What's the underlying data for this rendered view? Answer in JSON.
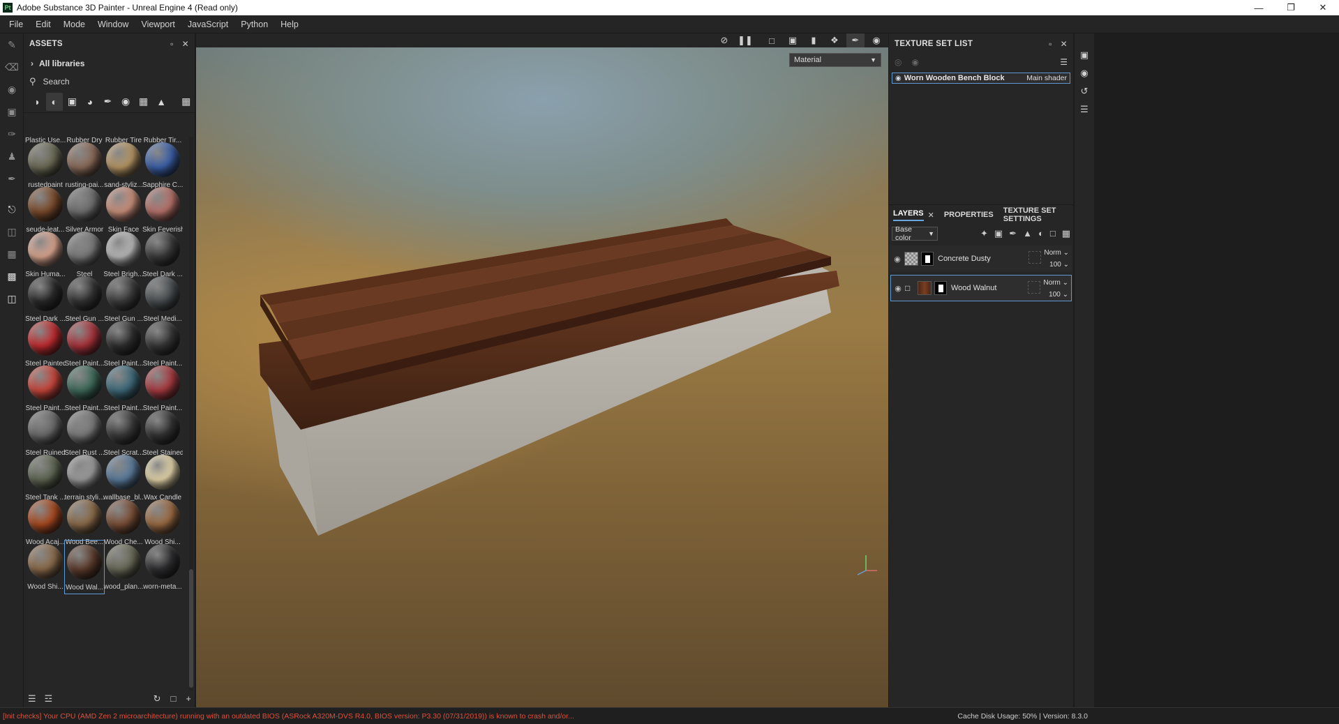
{
  "window": {
    "title": "Adobe Substance 3D Painter - Unreal Engine 4 (Read only)",
    "icon_text": "Pt",
    "controls": [
      "minimize-icon",
      "restore-icon",
      "close-icon"
    ]
  },
  "menu": [
    "File",
    "Edit",
    "Mode",
    "Window",
    "Viewport",
    "JavaScript",
    "Python",
    "Help"
  ],
  "assets": {
    "title": "ASSETS",
    "all_libraries": "All libraries",
    "search_placeholder": "Search",
    "filter_icons": [
      "materials-icon",
      "smart-materials-icon",
      "masks-icon",
      "generators-icon",
      "brushes-icon",
      "alphas-icon",
      "textures-icon",
      "environments-icon",
      "grid-view-icon"
    ],
    "materials": [
      {
        "label": "Plastic Use...",
        "color": "#6a5a48"
      },
      {
        "label": "Rubber Dry",
        "color": "#3a3836"
      },
      {
        "label": "Rubber Tire",
        "color": "#2a2a2a"
      },
      {
        "label": "Rubber Tir...",
        "color": "#2c2c2c"
      },
      {
        "label": "rustedpaint",
        "color": "#6b6a55"
      },
      {
        "label": "rusting-pai...",
        "color": "#8a6a58"
      },
      {
        "label": "sand-styliz...",
        "color": "#b59563"
      },
      {
        "label": "Sapphire C...",
        "color": "#3a5fa8"
      },
      {
        "label": "seude-leat...",
        "color": "#7a4a2a"
      },
      {
        "label": "Silver Armor",
        "color": "#6e6e6e"
      },
      {
        "label": "Skin Face",
        "color": "#c98e7a"
      },
      {
        "label": "Skin Feverish",
        "color": "#b7716a"
      },
      {
        "label": "Skin Huma...",
        "color": "#d9a48e"
      },
      {
        "label": "Steel",
        "color": "#7a7a7a"
      },
      {
        "label": "Steel Brigh...",
        "color": "#b8b8b8"
      },
      {
        "label": "Steel Dark ...",
        "color": "#3a3a3a"
      },
      {
        "label": "Steel Dark ...",
        "color": "#2a2a2a"
      },
      {
        "label": "Steel Gun ...",
        "color": "#333333"
      },
      {
        "label": "Steel Gun ...",
        "color": "#3c3c3c"
      },
      {
        "label": "Steel Medi...",
        "color": "#4a4f52"
      },
      {
        "label": "Steel Painted",
        "color": "#c02a2e"
      },
      {
        "label": "Steel Paint...",
        "color": "#a8323a"
      },
      {
        "label": "Steel Paint...",
        "color": "#2e2e2e"
      },
      {
        "label": "Steel Paint...",
        "color": "#363636"
      },
      {
        "label": "Steel Paint...",
        "color": "#c8453a"
      },
      {
        "label": "Steel Paint...",
        "color": "#3e6a5a"
      },
      {
        "label": "Steel Paint...",
        "color": "#3e6a7a"
      },
      {
        "label": "Steel Paint...",
        "color": "#a83a40"
      },
      {
        "label": "Steel Ruined",
        "color": "#6a6a6a"
      },
      {
        "label": "Steel Rust ...",
        "color": "#7a7a7a"
      },
      {
        "label": "Steel Scrat...",
        "color": "#3a3a3a"
      },
      {
        "label": "Steel Stained",
        "color": "#333333"
      },
      {
        "label": "Steel Tank ...",
        "color": "#5e6652"
      },
      {
        "label": "terrain styli...",
        "color": "#9a9a9a"
      },
      {
        "label": "wallbase_bl...",
        "color": "#5a7a9a"
      },
      {
        "label": "Wax Candle",
        "color": "#e2d4a8"
      },
      {
        "label": "Wood Acaj...",
        "color": "#a8481e"
      },
      {
        "label": "Wood Bee...",
        "color": "#8a6a48"
      },
      {
        "label": "Wood Che...",
        "color": "#7a4e36"
      },
      {
        "label": "Wood Shi...",
        "color": "#9a6a42"
      },
      {
        "label": "Wood Shi...",
        "color": "#8a6a4a"
      },
      {
        "label": "Wood Wal...",
        "color": "#5a3a2a"
      },
      {
        "label": "wood_plan...",
        "color": "#6a6a58"
      },
      {
        "label": "worn-meta...",
        "color": "#2e2e30"
      }
    ]
  },
  "viewport": {
    "channel_dropdown": "Material",
    "toolbar_icons": [
      "hide-ui-icon",
      "pause-icon",
      "display-mode-icon",
      "camera-mode-icon",
      "video-icon",
      "symmetry-icon",
      "paint-mode-icon",
      "screenshot-icon"
    ]
  },
  "texture_set_list": {
    "title": "TEXTURE SET LIST",
    "set_name": "Worn Wooden Bench Block",
    "shader": "Main shader"
  },
  "layers": {
    "tabs": [
      "LAYERS",
      "PROPERTIES",
      "TEXTURE SET SETTINGS"
    ],
    "channel": "Base color",
    "items": [
      {
        "name": "Concrete Dusty",
        "blend": "Norm",
        "opacity": "100"
      },
      {
        "name": "Wood Walnut",
        "blend": "Norm",
        "opacity": "100"
      }
    ]
  },
  "status": {
    "warning": "[Init checks] Your CPU (AMD Zen 2 microarchitecture) running with an outdated BIOS (ASRock A320M-DVS R4.0, BIOS version: P3.30 (07/31/2019)) is known to crash and/or...",
    "info": "Cache Disk Usage:   50% | Version: 8.3.0"
  },
  "colors": {
    "accent": "#5e9bd6",
    "warning": "#e0503a",
    "panel_bg": "#262626"
  }
}
